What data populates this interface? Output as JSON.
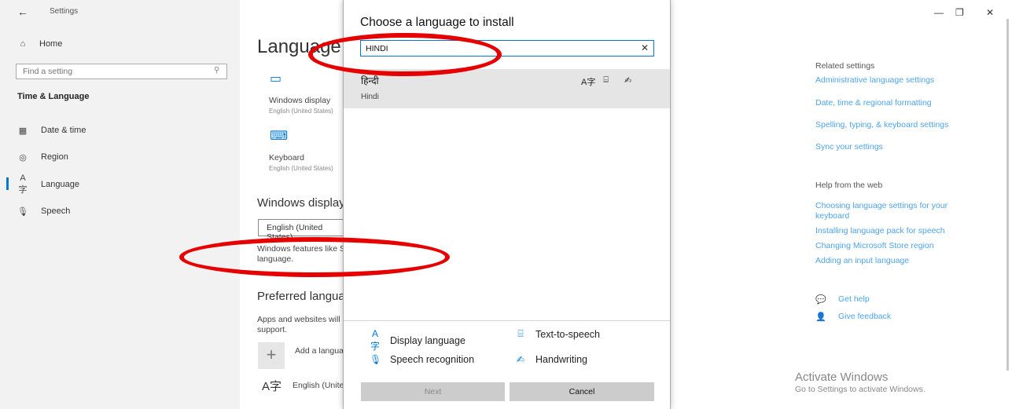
{
  "window": {
    "back": "←",
    "title": "Settings",
    "minimize": "—",
    "restore": "❐",
    "close": "✕"
  },
  "sidebar": {
    "home": "Home",
    "search_placeholder": "Find a setting",
    "section": "Time & Language",
    "items": [
      {
        "icon": "calendar-icon",
        "label": "Date & time"
      },
      {
        "icon": "globe-icon",
        "label": "Region"
      },
      {
        "icon": "language-icon",
        "label": "Language"
      },
      {
        "icon": "microphone-icon",
        "label": "Speech"
      }
    ]
  },
  "main": {
    "heading": "Language",
    "windows_display": "Windows display",
    "windows_display_sub": "English (United States)",
    "keyboard": "Keyboard",
    "keyboard_sub": "English (United States)",
    "display_section": "Windows display language",
    "display_select": "English (United States)",
    "display_desc_1": "Windows features like Settings and File Explorer will appear in this",
    "display_desc_2": "language.",
    "preferred_section": "Preferred languages",
    "preferred_desc_1": "Apps and websites will appear in the first language in the list that they",
    "preferred_desc_2": "support.",
    "add_language": "Add a language",
    "english_item": "English (United States)"
  },
  "dialog": {
    "title": "Choose a language to install",
    "search_value": "HINDI",
    "clear": "✕",
    "result": {
      "native": "हिन्दी",
      "english": "Hindi"
    },
    "legend": {
      "display_language": "Display language",
      "text_to_speech": "Text-to-speech",
      "speech_recognition": "Speech recognition",
      "handwriting": "Handwriting"
    },
    "next": "Next",
    "cancel": "Cancel"
  },
  "right": {
    "related_title": "Related settings",
    "related_links": [
      "Administrative language settings",
      "Date, time & regional formatting",
      "Spelling, typing, & keyboard settings",
      "Sync your settings"
    ],
    "help_title": "Help from the web",
    "help_links": [
      "Choosing language settings for your",
      "keyboard",
      "Installing language pack for speech",
      "Changing Microsoft Store region",
      "Adding an input language"
    ],
    "get_help": "Get help",
    "give_feedback": "Give feedback"
  },
  "activation": {
    "title": "Activate Windows",
    "subtitle": "Go to Settings to activate Windows."
  },
  "colors": {
    "accent": "#0078d7",
    "link": "#4da3e8",
    "annotation": "#e60000"
  }
}
